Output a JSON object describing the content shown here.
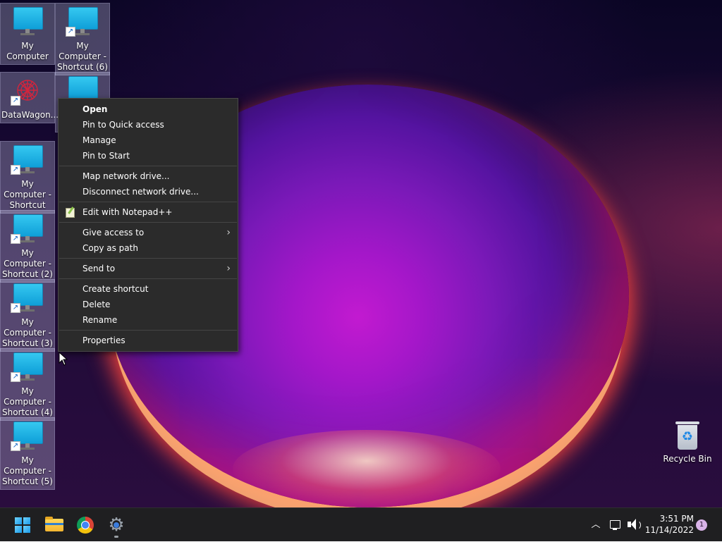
{
  "desktop": {
    "icons": [
      {
        "label": "My Computer"
      },
      {
        "label": "My Computer - Shortcut (6)"
      },
      {
        "label": "DataWagon..."
      },
      {
        "label": "My Computer - Shortcut"
      },
      {
        "label": "My Computer - Shortcut (2)"
      },
      {
        "label": "My Computer - Shortcut (3)"
      },
      {
        "label": "My Computer - Shortcut (4)"
      },
      {
        "label": "My Computer - Shortcut (5)"
      }
    ],
    "recycle_bin": {
      "label": "Recycle Bin"
    }
  },
  "context_menu": {
    "items": [
      {
        "label": "Open"
      },
      {
        "label": "Pin to Quick access"
      },
      {
        "label": "Manage"
      },
      {
        "label": "Pin to Start"
      },
      {
        "label": "Map network drive..."
      },
      {
        "label": "Disconnect network drive..."
      },
      {
        "label": "Edit with Notepad++",
        "icon": "notepad-plus-plus-icon"
      },
      {
        "label": "Give access to",
        "submenu": true
      },
      {
        "label": "Copy as path"
      },
      {
        "label": "Send to",
        "submenu": true
      },
      {
        "label": "Create shortcut"
      },
      {
        "label": "Delete"
      },
      {
        "label": "Rename"
      },
      {
        "label": "Properties"
      }
    ],
    "submenu_arrow": "›"
  },
  "taskbar": {
    "pinned": [
      {
        "name": "start",
        "icon": "windows-logo-icon"
      },
      {
        "name": "file-explorer",
        "icon": "folder-icon"
      },
      {
        "name": "chrome",
        "icon": "chrome-icon"
      },
      {
        "name": "settings",
        "icon": "gear-icon",
        "running": true
      }
    ],
    "tray": {
      "chevron": "︿",
      "time": "3:51 PM",
      "date": "11/14/2022",
      "notification_count": "1"
    }
  },
  "colors": {
    "taskbar_bg": "#1f1f21",
    "menu_bg": "#2b2b2b",
    "accent": "#1a9ae8"
  }
}
